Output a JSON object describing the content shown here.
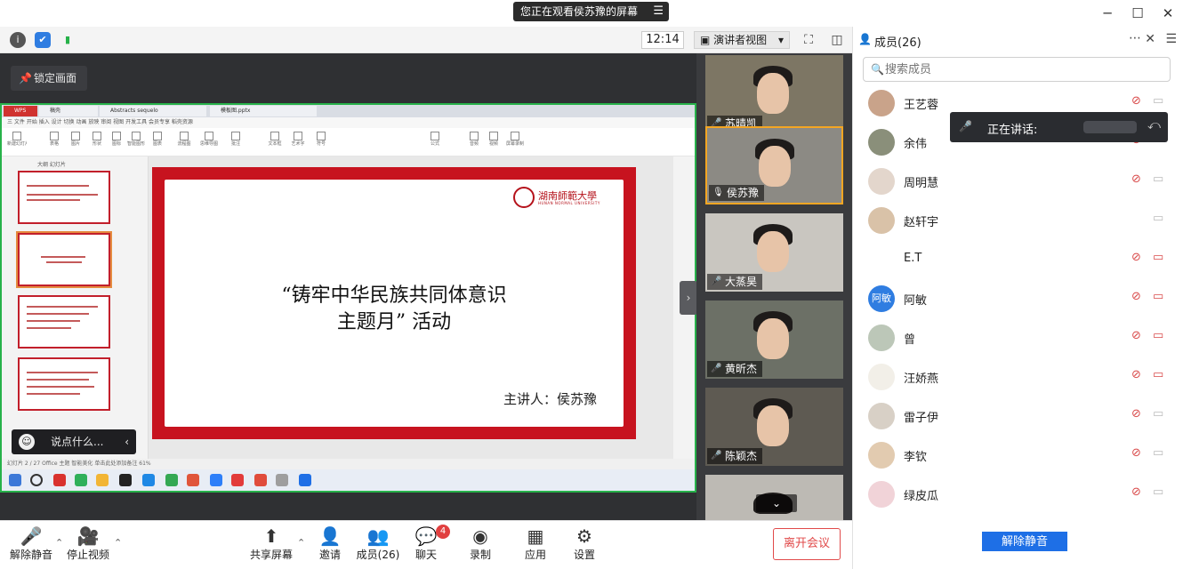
{
  "title_bar": {
    "share_notice": "您正在观看侯苏豫的屏幕",
    "menu_icon": "menu-icon",
    "window_buttons": [
      "minimize-icon",
      "maximize-icon",
      "close-icon"
    ]
  },
  "top_toolbar": {
    "clock": "12:14",
    "view_mode": "演讲者视图",
    "lock_screen": "锁定画面"
  },
  "shared_screen": {
    "ppt_tabs": [
      "WPS Office",
      "稿壳",
      "Abstracts sequelo",
      "模板图.pptx"
    ],
    "ppt_menu": "三 文件  开始  插入  设计  切换  动画  放映  审阅  视图  开发工具  会员专享  稻壳资源",
    "ribbon_items": [
      "新建幻灯片",
      "表格",
      "图片",
      "形状",
      "图标",
      "智能图形",
      "图表",
      "流程图",
      "思维导图",
      "批注",
      "文本框",
      "艺术字",
      "符号",
      "公式",
      "音频",
      "视频",
      "屏幕录制"
    ],
    "side_tabs": "大纲   幻灯片",
    "slide": {
      "university_name": "湖南師範大學",
      "university_sub": "HUNAN NORMAL UNIVERSITY",
      "title_line1": "“铸牢中华民族共同体意识",
      "title_line2": "主题月”  活动",
      "speaker": "主讲人：侯苏豫"
    },
    "status_bar": "幻灯片 2 / 27     Office 主题     智能美化        单击此处添加备注                                                     61%"
  },
  "chat_hint": "说点什么...",
  "video_tiles": [
    {
      "name": "苏晴凯"
    },
    {
      "name": "侯苏豫"
    },
    {
      "name": "大蒸昊"
    },
    {
      "name": "黄昕杰"
    },
    {
      "name": "陈颖杰"
    },
    {
      "name": ""
    }
  ],
  "members_panel": {
    "title": "成员(26)",
    "search_placeholder": "搜索成员",
    "speaking_label": "正在讲话:",
    "members": [
      {
        "name": "王艺蓉",
        "avatar": "",
        "avatar_color": "#c9a38a",
        "mic_muted": true,
        "cam_off": false
      },
      {
        "name": "余伟",
        "avatar": "",
        "avatar_color": "#8a8f7a",
        "mic_muted": true,
        "cam_off": false
      },
      {
        "name": "周明慧",
        "avatar": "",
        "avatar_color": "#e3d6cc",
        "mic_muted": true,
        "cam_off": false
      },
      {
        "name": "赵轩宇",
        "avatar": "",
        "avatar_color": "#d9c2a8",
        "mic_muted": false,
        "cam_off": false
      },
      {
        "name": "E.T",
        "avatar": "",
        "avatar_color": "#ffffff",
        "mic_muted": true,
        "cam_off": true
      },
      {
        "name": "阿敏",
        "avatar": "阿敏",
        "avatar_color": "#2f7de1",
        "mic_muted": true,
        "cam_off": true
      },
      {
        "name": "曾",
        "avatar": "",
        "avatar_color": "#bcc7b8",
        "mic_muted": true,
        "cam_off": true
      },
      {
        "name": "汪娇燕",
        "avatar": "",
        "avatar_color": "#f2efe8",
        "mic_muted": true,
        "cam_off": true
      },
      {
        "name": "雷子伊",
        "avatar": "",
        "avatar_color": "#d8d0c6",
        "mic_muted": true,
        "cam_off": false
      },
      {
        "name": "李钦",
        "avatar": "",
        "avatar_color": "#e2cbb0",
        "mic_muted": true,
        "cam_off": false
      },
      {
        "name": "绿皮瓜",
        "avatar": "",
        "avatar_color": "#f1d3d8",
        "mic_muted": true,
        "cam_off": false
      }
    ],
    "unmute_all": "解除静音"
  },
  "controls": {
    "unmute": "解除静音",
    "stop_video": "停止视频",
    "share_screen": "共享屏幕",
    "invite": "邀请",
    "members": "成员(26)",
    "chat": "聊天",
    "chat_badge": "4",
    "record": "录制",
    "apps": "应用",
    "settings": "设置",
    "leave": "离开会议"
  },
  "colors": {
    "accent": "#1e6fe6",
    "danger": "#e14a4a",
    "share_border": "#27b24a",
    "slide_red": "#c7131f"
  }
}
